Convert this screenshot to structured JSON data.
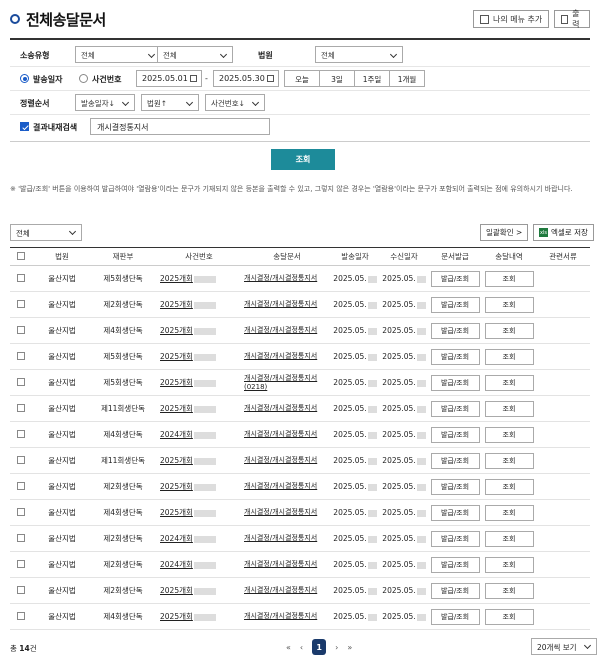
{
  "title": "전체송달문서",
  "header": {
    "menu_add_label": "나의 메뉴 추가",
    "print_label": "출력"
  },
  "search": {
    "type_label": "소송유형",
    "type_value1": "전체",
    "type_value2": "전체",
    "court_label": "법원",
    "court_value": "전체",
    "radio_date_label": "발송일자",
    "radio_case_label": "사건번호",
    "date_from": "2025.05.01",
    "date_to": "2025.05.30",
    "date_sep": "-",
    "period_buttons": [
      "오늘",
      "3일",
      "1주일",
      "1개월"
    ],
    "sort_label": "정렬순서",
    "sort_options": [
      "발송일자↓",
      "법원↑",
      "사건번호↓"
    ],
    "result_search_label": "결과내재검색",
    "result_search_value": "개시결정통지서",
    "submit_label": "조회"
  },
  "notice": "※ '발급/조회' 버튼을 이용하여 발급하여야 '열람용'이라는 문구가 기재되지 않은 등본을 출력할 수 있고, 그렇지 않은 경우는 '열람용'이라는 문구가 포함되어 출력되는 점에 유의하시기 바랍니다.",
  "toolbar": {
    "filter_value": "전체",
    "bulk_check_label": "일괄확인 >",
    "excel_icon_text": "xls",
    "excel_label": "엑셀로 저장"
  },
  "table": {
    "headers": [
      "법원",
      "재판부",
      "사건번호",
      "송달문서",
      "발송일자",
      "수신일자",
      "문서발급",
      "송달내역",
      "관련서류"
    ],
    "issue_label": "발급/조회",
    "view_label": "조회",
    "rows": [
      {
        "court": "울산지법",
        "dept": "제5회생단독",
        "case": "2025개회",
        "doc": "개시결정/개시결정통지서",
        "sent": "2025.05.",
        "recv": "2025.05."
      },
      {
        "court": "울산지법",
        "dept": "제2회생단독",
        "case": "2025개회",
        "doc": "개시결정/개시결정통지서",
        "sent": "2025.05.",
        "recv": "2025.05."
      },
      {
        "court": "울산지법",
        "dept": "제4회생단독",
        "case": "2025개회",
        "doc": "개시결정/개시결정통지서",
        "sent": "2025.05.",
        "recv": "2025.05."
      },
      {
        "court": "울산지법",
        "dept": "제5회생단독",
        "case": "2025개회",
        "doc": "개시결정/개시결정통지서",
        "sent": "2025.05.",
        "recv": "2025.05."
      },
      {
        "court": "울산지법",
        "dept": "제5회생단독",
        "case": "2025개회",
        "doc": "개시결정/개시결정통지서(0218)",
        "sent": "2025.05.",
        "recv": "2025.05."
      },
      {
        "court": "울산지법",
        "dept": "제11회생단독",
        "case": "2025개회",
        "doc": "개시결정/개시결정통지서",
        "sent": "2025.05.",
        "recv": "2025.05."
      },
      {
        "court": "울산지법",
        "dept": "제4회생단독",
        "case": "2024개회",
        "doc": "개시결정/개시결정통지서",
        "sent": "2025.05.",
        "recv": "2025.05."
      },
      {
        "court": "울산지법",
        "dept": "제11회생단독",
        "case": "2025개회",
        "doc": "개시결정/개시결정통지서",
        "sent": "2025.05.",
        "recv": "2025.05."
      },
      {
        "court": "울산지법",
        "dept": "제2회생단독",
        "case": "2025개회",
        "doc": "개시결정/개시결정통지서",
        "sent": "2025.05.",
        "recv": "2025.05."
      },
      {
        "court": "울산지법",
        "dept": "제4회생단독",
        "case": "2025개회",
        "doc": "개시결정/개시결정통지서",
        "sent": "2025.05.",
        "recv": "2025.05."
      },
      {
        "court": "울산지법",
        "dept": "제2회생단독",
        "case": "2024개회",
        "doc": "개시결정/개시결정통지서",
        "sent": "2025.05.",
        "recv": "2025.05."
      },
      {
        "court": "울산지법",
        "dept": "제2회생단독",
        "case": "2024개회",
        "doc": "개시결정/개시결정통지서",
        "sent": "2025.05.",
        "recv": "2025.05."
      },
      {
        "court": "울산지법",
        "dept": "제2회생단독",
        "case": "2025개회",
        "doc": "개시결정/개시결정통지서",
        "sent": "2025.05.",
        "recv": "2025.05."
      },
      {
        "court": "울산지법",
        "dept": "제4회생단독",
        "case": "2025개회",
        "doc": "개시결정/개시결정통지서",
        "sent": "2025.05.",
        "recv": "2025.05."
      }
    ]
  },
  "footer": {
    "total_prefix": "총",
    "total_count": "14",
    "total_suffix": "건",
    "pager": {
      "first": "«",
      "prev": "‹",
      "current": "1",
      "next": "›",
      "last": "»"
    },
    "per_page": "20개씩 보기"
  }
}
